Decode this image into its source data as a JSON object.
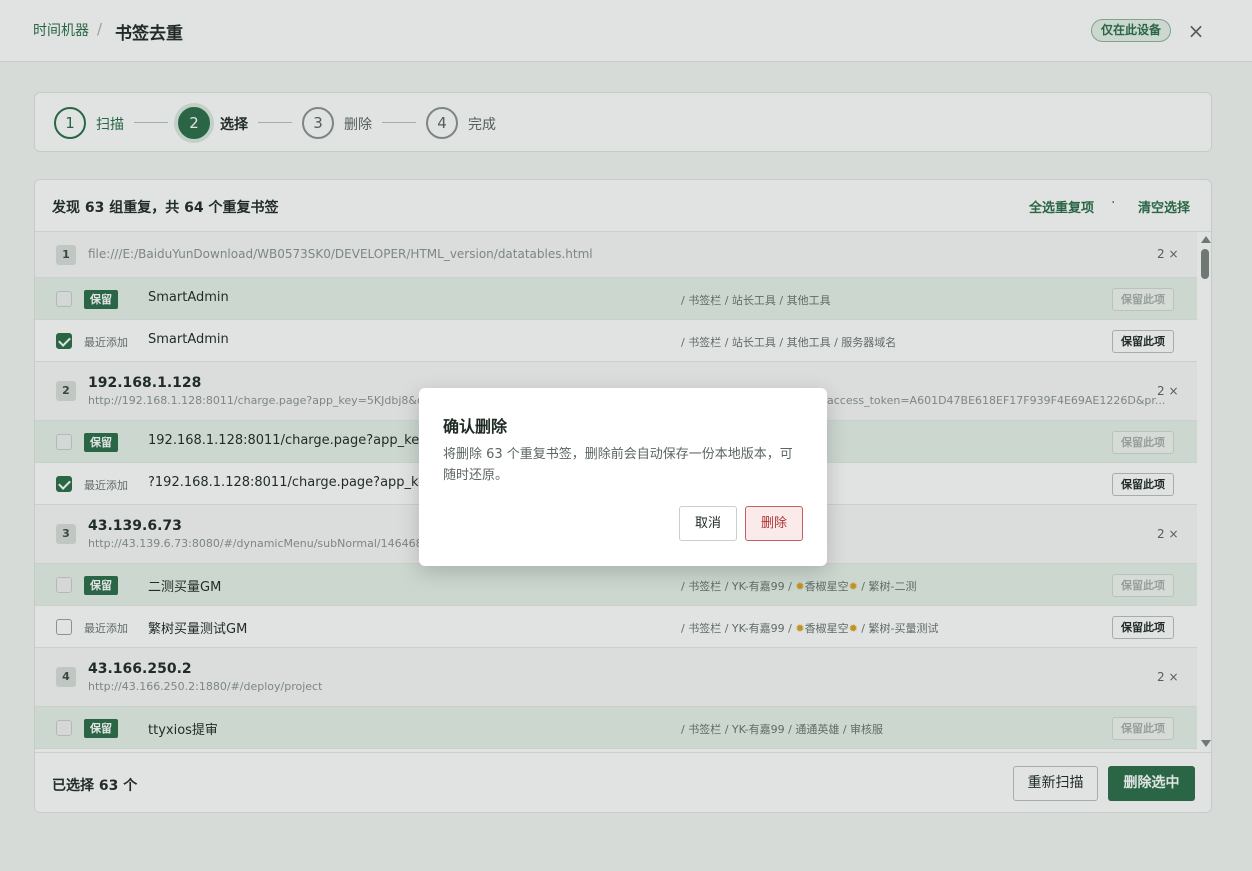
{
  "header": {
    "breadcrumb_root": "时间机器",
    "breadcrumb_sep": "/",
    "title": "书签去重",
    "device_badge": "仅在此设备",
    "close_symbol": "×"
  },
  "stepper": {
    "steps": [
      {
        "num": "1",
        "label": "扫描",
        "state": "done"
      },
      {
        "num": "2",
        "label": "选择",
        "state": "active"
      },
      {
        "num": "3",
        "label": "删除",
        "state": "todo"
      },
      {
        "num": "4",
        "label": "完成",
        "state": "todo"
      }
    ]
  },
  "panel": {
    "summary": "发现 63 组重复，共 64 个重复书签",
    "select_all": "全选重复项",
    "dot": "·",
    "clear": "清空选择",
    "groups": [
      {
        "num": "1",
        "host": "",
        "url": "file:///E:/BaiduYunDownload/WB0573SK0/DEVELOPER/HTML_version/datatables.html",
        "count": "2 ×",
        "rows": [
          {
            "tag": "保留",
            "title": "SmartAdmin",
            "path": "/ 书签栏 / 站长工具 / 其他工具",
            "btn": "保留此项"
          },
          {
            "tag": "最近添加",
            "title": "SmartAdmin",
            "path": "/ 书签栏 / 站长工具 / 其他工具 / 服务器域名",
            "btn": "保留此项"
          }
        ]
      },
      {
        "num": "2",
        "host": "192.168.1.128",
        "url": "http://192.168.1.128:8011/charge.page?app_key=5KJdbj8&dev",
        "url_tail": "access_token=A601D47BE618EF17F939F4E69AE1226D&pr...",
        "count": "2 ×",
        "rows": [
          {
            "tag": "保留",
            "title": "192.168.1.128:8011/charge.page?app_key=5",
            "path": "",
            "btn": "保留此项"
          },
          {
            "tag": "最近添加",
            "title": "?192.168.1.128:8011/charge.page?app_key=",
            "path": "",
            "btn": "保留此项"
          }
        ]
      },
      {
        "num": "3",
        "host": "43.139.6.73",
        "url": "http://43.139.6.73:8080/#/dynamicMenu/subNormal/1464686",
        "count": "2 ×",
        "rows": [
          {
            "tag": "保留",
            "title": "二测买量GM",
            "path_a": "/ 书签栏 / YK-有嘉99 / ",
            "path_b": "香椒星空",
            "path_c": " / 繁树-二测",
            "btn": "保留此项"
          },
          {
            "tag": "最近添加",
            "title": "繁树买量测试GM",
            "path_a": "/ 书签栏 / YK-有嘉99 / ",
            "path_b": "香椒星空",
            "path_c": " / 繁树-买量测试",
            "btn": "保留此项"
          }
        ]
      },
      {
        "num": "4",
        "host": "43.166.250.2",
        "url": "http://43.166.250.2:1880/#/deploy/project",
        "count": "2 ×",
        "rows": [
          {
            "tag": "保留",
            "title": "ttyxios提审",
            "path": "/ 书签栏 / YK-有嘉99 / 通通英雄 / 审核服",
            "btn": "保留此项"
          }
        ]
      }
    ],
    "footer": {
      "selected": "已选择 63 个",
      "rescan": "重新扫描",
      "delete_selected": "删除选中"
    }
  },
  "modal": {
    "title": "确认删除",
    "text": "将删除 63 个重复书签，删除前会自动保存一份本地版本，可随时还原。",
    "cancel": "取消",
    "confirm": "删除"
  },
  "colors": {
    "accent": "#2b6e4a",
    "keep_row_bg": "#e7f1ea",
    "danger": "#b03434"
  }
}
